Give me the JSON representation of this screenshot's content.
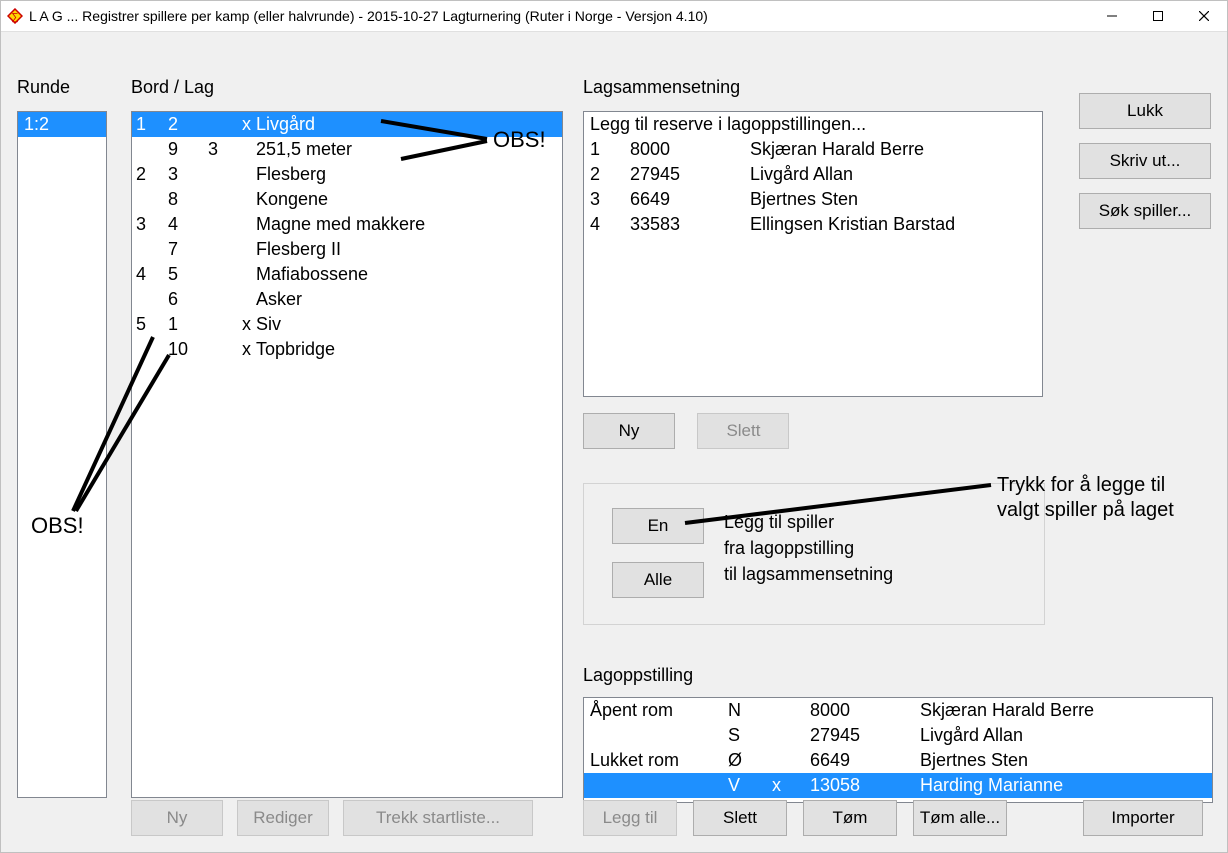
{
  "window": {
    "title": "L A G ... Registrer spillere per kamp (eller halvrunde) - 2015-10-27  Lagturnering  (Ruter i Norge - Versjon 4.10)"
  },
  "labels": {
    "runde": "Runde",
    "bord_lag": "Bord / Lag",
    "lagsammensetning": "Lagsammensetning",
    "lagoppstilling": "Lagoppstilling"
  },
  "runde_list": [
    "1:2"
  ],
  "bord_list": [
    {
      "n1": "1",
      "n2": "2",
      "n3": "",
      "x": "x",
      "name": "Livgård",
      "sel": true
    },
    {
      "n1": "",
      "n2": "9",
      "n3": "3",
      "x": "",
      "name": "251,5 meter",
      "sel": false
    },
    {
      "n1": "2",
      "n2": "3",
      "n3": "",
      "x": "",
      "name": "Flesberg",
      "sel": false
    },
    {
      "n1": "",
      "n2": "8",
      "n3": "",
      "x": "",
      "name": "Kongene",
      "sel": false
    },
    {
      "n1": "3",
      "n2": "4",
      "n3": "",
      "x": "",
      "name": "Magne med makkere",
      "sel": false
    },
    {
      "n1": "",
      "n2": "7",
      "n3": "",
      "x": "",
      "name": "Flesberg II",
      "sel": false
    },
    {
      "n1": "4",
      "n2": "5",
      "n3": "",
      "x": "",
      "name": "Mafiabossene",
      "sel": false
    },
    {
      "n1": "",
      "n2": "6",
      "n3": "",
      "x": "",
      "name": "Asker",
      "sel": false
    },
    {
      "n1": "5",
      "n2": "1",
      "n3": "",
      "x": "x",
      "name": "Siv",
      "sel": false
    },
    {
      "n1": "",
      "n2": "10",
      "n3": "",
      "x": "x",
      "name": "Topbridge",
      "sel": false
    }
  ],
  "lagsam_first": "Legg til reserve i lagoppstillingen...",
  "lagsam_list": [
    {
      "idx": "1",
      "num": "8000",
      "name": "Skjæran Harald Berre"
    },
    {
      "idx": "2",
      "num": "27945",
      "name": "Livgård Allan"
    },
    {
      "idx": "3",
      "num": "6649",
      "name": "Bjertnes Sten"
    },
    {
      "idx": "4",
      "num": "33583",
      "name": "Ellingsen Kristian Barstad"
    }
  ],
  "group_text": {
    "l1": "Legg til spiller",
    "l2": "fra lagoppstilling",
    "l3": "til lagsammensetning"
  },
  "lagopp_list": [
    {
      "room": "Åpent rom",
      "pos": "N",
      "x": "",
      "num": "8000",
      "name": "Skjæran Harald Berre",
      "sel": false
    },
    {
      "room": "",
      "pos": "S",
      "x": "",
      "num": "27945",
      "name": "Livgård Allan",
      "sel": false
    },
    {
      "room": "Lukket rom",
      "pos": "Ø",
      "x": "",
      "num": "6649",
      "name": "Bjertnes Sten",
      "sel": false
    },
    {
      "room": "",
      "pos": "V",
      "x": "x",
      "num": "13058",
      "name": "Harding Marianne",
      "sel": true
    }
  ],
  "buttons": {
    "lukk": "Lukk",
    "skriv_ut": "Skriv ut...",
    "sok_spiller": "Søk spiller...",
    "ny": "Ny",
    "slett": "Slett",
    "en": "En",
    "alle": "Alle",
    "rediger": "Rediger",
    "trekk": "Trekk startliste...",
    "legg_til": "Legg til",
    "tom": "Tøm",
    "tom_alle": "Tøm alle...",
    "importer": "Importer"
  },
  "annotations": {
    "obs": "OBS!",
    "trykk1": "Trykk for å legge til",
    "trykk2": "valgt spiller på laget"
  }
}
